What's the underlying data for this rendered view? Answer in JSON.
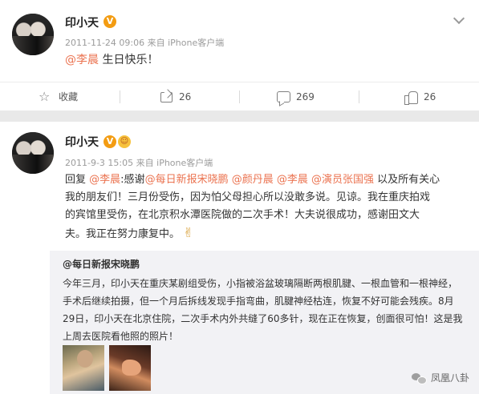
{
  "post1": {
    "author": "印小天",
    "time": "2011-11-24 09:06",
    "source": "来自 iPhone客户端",
    "mention": "@李晨",
    "text_after_mention": " 生日快乐！",
    "actions": {
      "favorite_label": "收藏",
      "share_count": "26",
      "comment_count": "269",
      "like_count": "26"
    }
  },
  "post2": {
    "author": "印小天",
    "time": "2011-9-3 15:05",
    "source": "来自 iPhone客户端",
    "reply_prefix": "回复",
    "mention1": "@李晨",
    "thanks": ":感谢",
    "mention2": "@每日新报宋晓鹏",
    "mention3": "@颜丹晨",
    "mention4": "@李晨",
    "mention5": "@演员张国强",
    "line1_tail": " 以及所有关心",
    "line2": "我的朋友们！三月份受伤，因为怕父母担心所以没敢多说。见谅。我在重庆拍戏",
    "line3": "的宾馆里受伤，在北京积水潭医院做的二次手术！大夫说很成功，感谢田文大",
    "line4": "夫。我正在努力康复中。",
    "emoji": "✌",
    "quote": {
      "author": "@每日新报宋晓鹏",
      "line1": "今年三月，印小天在重庆某剧组受伤，小指被浴盆玻璃隔断两根肌腱、一根血管和一根神经，",
      "line2": "手术后继续拍摄，但一个月后拆线发现手指弯曲，肌腱神经枯连，恢复不好可能会残疾。8月",
      "line3": "29日，印小天在北京住院，二次手术内外共缝了60多针，现在正在恢复，创面很可怕！这是我",
      "line4": "上周去医院看他照的照片！"
    }
  },
  "watermark": "凤凰八卦",
  "colors": {
    "mention": "#eb7350",
    "vip_badge": "#f39c12",
    "quote_bg": "#f2f2f5"
  }
}
